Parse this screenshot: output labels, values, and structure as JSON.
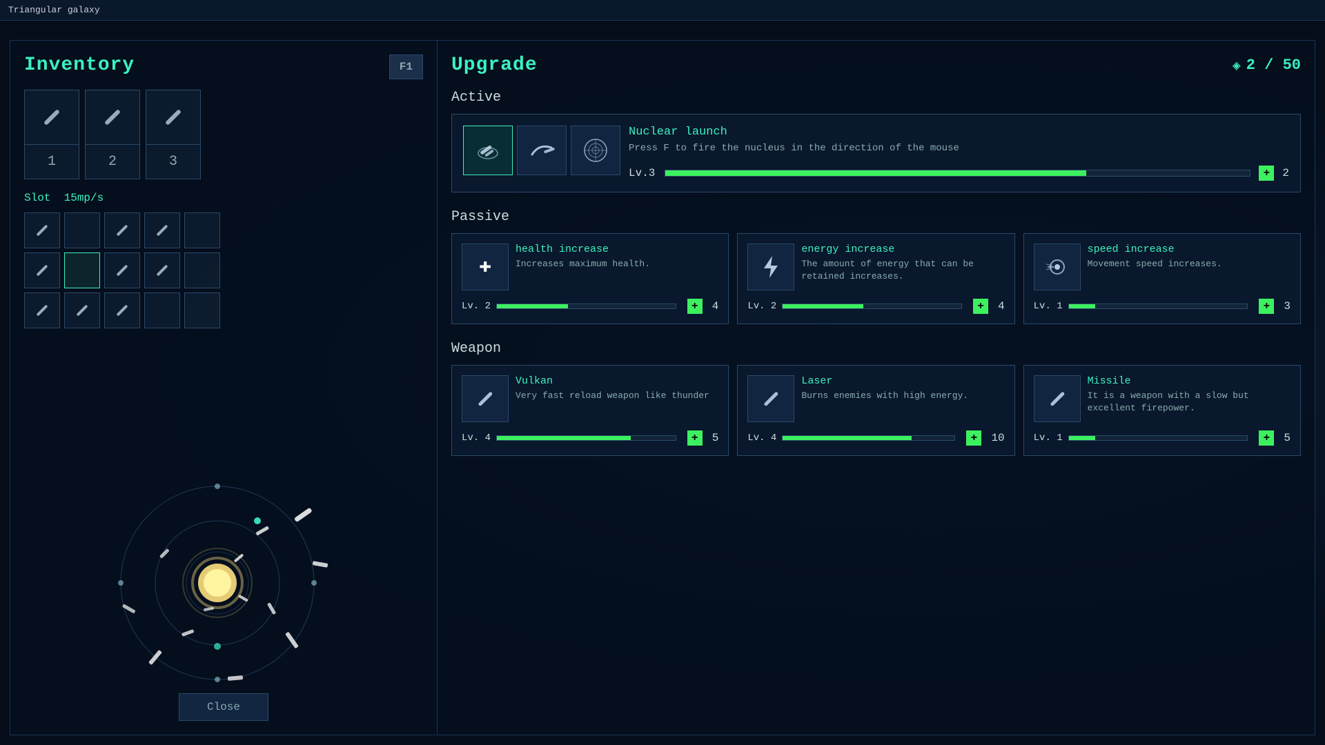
{
  "titleBar": {
    "title": "Triangular galaxy"
  },
  "inventory": {
    "title": "Inventory",
    "f1Label": "F1",
    "slotLabel": "Slot",
    "slotRate": "15mp/s",
    "weaponSlots": [
      {
        "hasItem": true
      },
      {
        "hasItem": true
      },
      {
        "hasItem": true
      }
    ],
    "slotNumbers": [
      "1",
      "2",
      "3"
    ],
    "smallSlots": [
      [
        {
          "hasItem": true
        },
        {
          "hasItem": false
        },
        {
          "hasItem": true
        },
        {
          "hasItem": true
        },
        {
          "hasItem": false
        }
      ],
      [
        {
          "hasItem": true
        },
        {
          "hasItem": false,
          "active": true
        },
        {
          "hasItem": true
        },
        {
          "hasItem": true
        },
        {
          "hasItem": false
        }
      ],
      [
        {
          "hasItem": true
        },
        {
          "hasItem": true
        },
        {
          "hasItem": true
        },
        {
          "hasItem": false
        },
        {
          "hasItem": false
        }
      ]
    ]
  },
  "closeButton": "Close",
  "upgrade": {
    "title": "Upgrade",
    "currency": {
      "icon": "◈",
      "current": 2,
      "max": 50,
      "display": "2 / 50"
    },
    "active": {
      "sectionLabel": "Active",
      "icons": [
        "✦",
        "⟿",
        "◉"
      ],
      "selectedIndex": 0,
      "name": "Nuclear launch",
      "description": "Press F to fire the nucleus in the direction of the mouse",
      "level": "Lv.3",
      "progressPct": 72,
      "cost": 2
    },
    "passive": {
      "sectionLabel": "Passive",
      "items": [
        {
          "name": "health increase",
          "description": "Increases maximum health.",
          "level": "Lv. 2",
          "progressPct": 40,
          "cost": 4,
          "iconType": "cross"
        },
        {
          "name": "energy increase",
          "description": "The amount of energy that can be retained increases.",
          "level": "Lv. 2",
          "progressPct": 45,
          "cost": 4,
          "iconType": "bolt"
        },
        {
          "name": "speed increase",
          "description": "Movement speed increases.",
          "level": "Lv. 1",
          "progressPct": 15,
          "cost": 3,
          "iconType": "speed"
        }
      ]
    },
    "weapon": {
      "sectionLabel": "Weapon",
      "items": [
        {
          "name": "Vulkan",
          "description": "Very fast reload weapon like thunder",
          "level": "Lv. 4",
          "progressPct": 75,
          "cost": 5,
          "iconType": "slash"
        },
        {
          "name": "Laser",
          "description": "Burns enemies with high energy.",
          "level": "Lv. 4",
          "progressPct": 75,
          "cost": 10,
          "iconType": "slash"
        },
        {
          "name": "Missile",
          "description": "It is a weapon with a slow but excellent firepower.",
          "level": "Lv. 1",
          "progressPct": 15,
          "cost": 5,
          "iconType": "slash"
        }
      ]
    }
  }
}
